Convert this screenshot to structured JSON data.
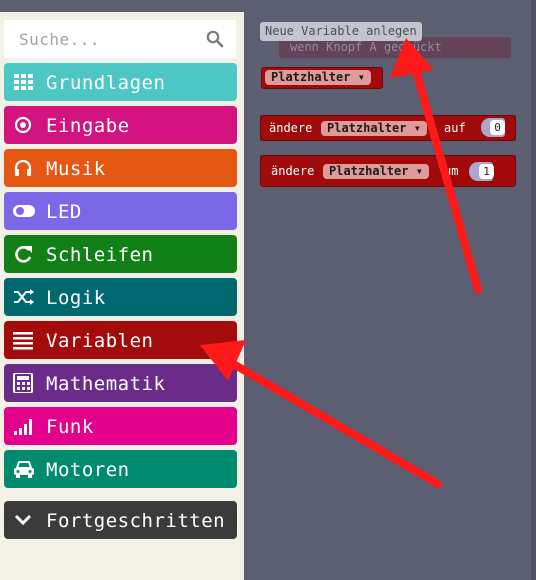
{
  "search": {
    "placeholder": "Suche..."
  },
  "categories": [
    {
      "label": "Grundlagen",
      "icon": "grid-icon",
      "color": "#4cc7c5"
    },
    {
      "label": "Eingabe",
      "icon": "target-icon",
      "color": "#d3137f"
    },
    {
      "label": "Musik",
      "icon": "headphones-icon",
      "color": "#e45813"
    },
    {
      "label": "LED",
      "icon": "toggle-icon",
      "color": "#7b68e6"
    },
    {
      "label": "Schleifen",
      "icon": "refresh-icon",
      "color": "#118117"
    },
    {
      "label": "Logik",
      "icon": "shuffle-icon",
      "color": "#006970"
    },
    {
      "label": "Variablen",
      "icon": "list-icon",
      "color": "#a40b0b"
    },
    {
      "label": "Mathematik",
      "icon": "calculator-icon",
      "color": "#6b2b88"
    },
    {
      "label": "Funk",
      "icon": "signal-icon",
      "color": "#e3008c"
    },
    {
      "label": "Motoren",
      "icon": "car-icon",
      "color": "#008a6e"
    },
    {
      "label": "Fortgeschritten",
      "icon": "chevron-down-icon",
      "color": "#3b3b3b"
    }
  ],
  "flyout": {
    "new_variable_button": "Neue Variable anlegen",
    "ghost_block": "wenn Knopf A gedrückt",
    "variable_block": {
      "name": "Platzhalter"
    },
    "set_block": {
      "prefix": "ändere",
      "variable": "Platzhalter",
      "suffix": "auf",
      "value": "0"
    },
    "change_block": {
      "prefix": "ändere",
      "variable": "Platzhalter",
      "suffix": "um",
      "value": "1"
    }
  },
  "annotation_color": "#ff1a1a"
}
